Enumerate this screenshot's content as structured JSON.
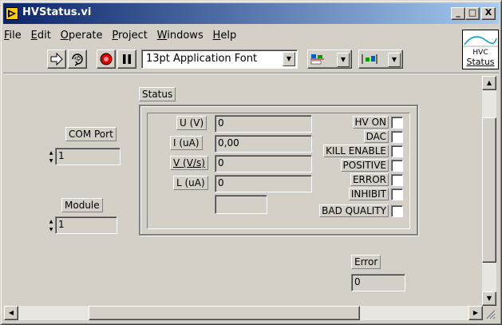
{
  "window": {
    "title": "HVStatus.vi"
  },
  "title_buttons": {
    "minimize": "_",
    "maximize": "□",
    "close": "X"
  },
  "menu": [
    {
      "mnemonic": "F",
      "rest": "ile"
    },
    {
      "mnemonic": "E",
      "rest": "dit"
    },
    {
      "mnemonic": "O",
      "rest": "perate"
    },
    {
      "mnemonic": "P",
      "rest": "roject"
    },
    {
      "mnemonic": "W",
      "rest": "indows"
    },
    {
      "mnemonic": "H",
      "rest": "elp"
    }
  ],
  "toolbar": {
    "font": "13pt Application Font"
  },
  "vi_icon": {
    "caption": "HVC",
    "label": "Status"
  },
  "controls": {
    "com_port": {
      "label": "COM Port",
      "value": "1"
    },
    "module": {
      "label": "Module",
      "value": "1"
    }
  },
  "status": {
    "label": "Status",
    "fields": [
      {
        "label": "U (V)",
        "value": "0"
      },
      {
        "label": "I (uA)",
        "value": "0,00"
      },
      {
        "label": "V (V/s)",
        "value": "0"
      },
      {
        "label": "L (uA)",
        "value": "0"
      }
    ],
    "extra_field": "",
    "leds": [
      "HV ON",
      "DAC",
      "KILL ENABLE",
      "POSITIVE",
      "ERROR",
      "INHIBIT",
      "BAD QUALITY"
    ]
  },
  "error": {
    "label": "Error",
    "value": "0"
  },
  "colors": {
    "titlebar_start": "#0a246a",
    "titlebar_end": "#a6caf0",
    "face": "#d4d0c8"
  }
}
